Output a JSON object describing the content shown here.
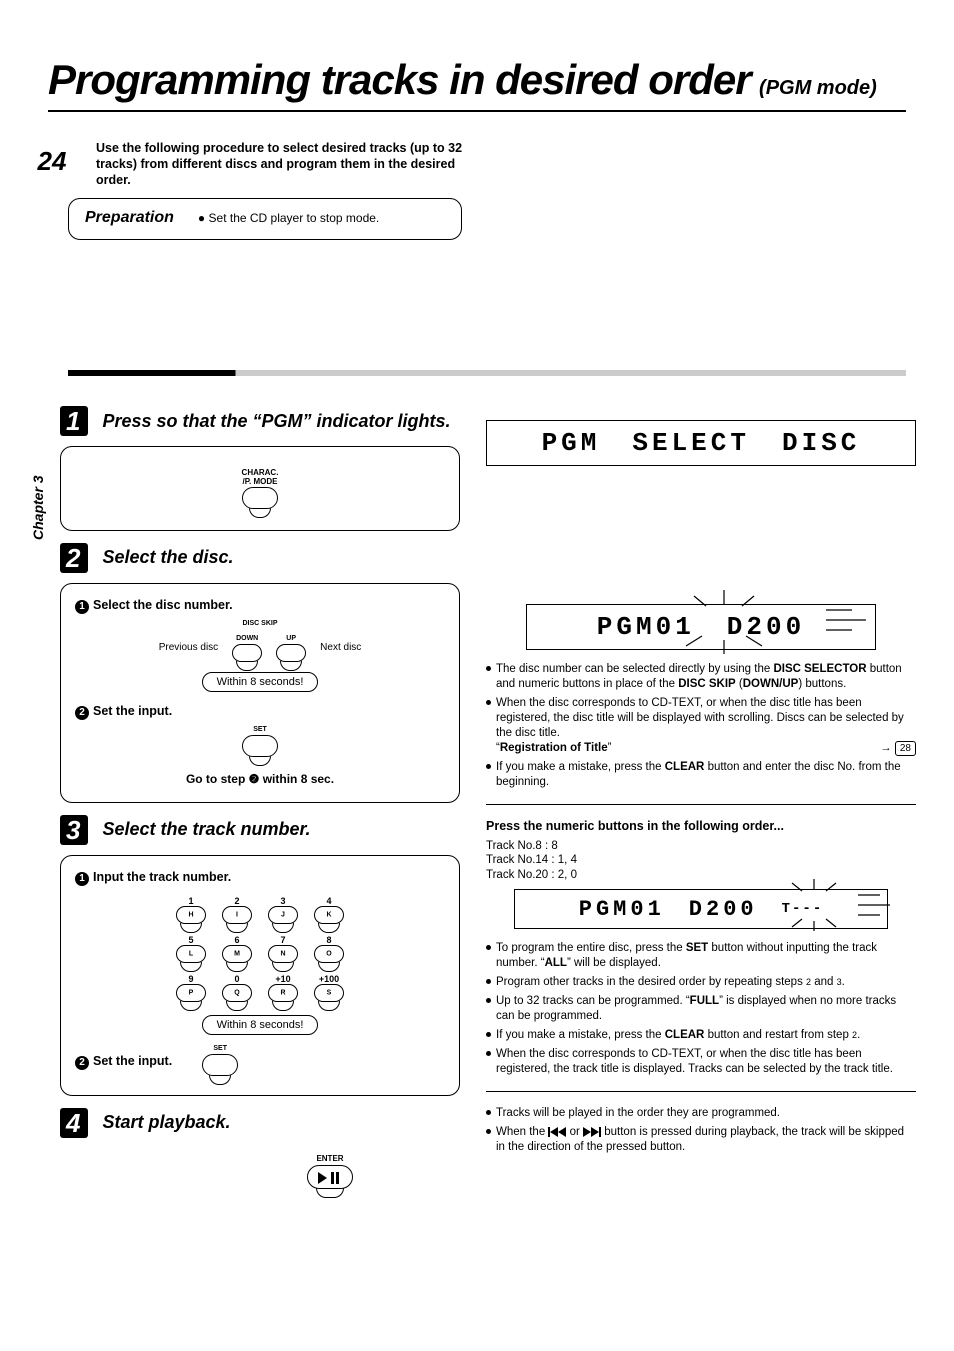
{
  "page_number": "24",
  "chapter_label": "Chapter 3",
  "title": {
    "main": "Programming tracks in desired order",
    "sub": "(PGM mode)"
  },
  "intro": "Use the following procedure to select desired tracks (up to 32 tracks) from different discs and program them in the desired order.",
  "preparation": {
    "heading": "Preparation",
    "item": "Set the CD player to stop mode."
  },
  "steps": {
    "s1": {
      "num": "1",
      "title": "Press so that the “PGM” indicator lights.",
      "btn_top": "CHARAC.",
      "btn_bot": "/P. MODE"
    },
    "s2": {
      "num": "2",
      "title": "Select the disc.",
      "sub1": "Select the disc number.",
      "disc_skip": "DISC SKIP",
      "down": "DOWN",
      "up": "UP",
      "prev": "Previous disc",
      "next": "Next disc",
      "within": "Within 8 seconds!",
      "sub2": "Set the input.",
      "set_label": "SET",
      "goto": "Go to step ❷ within 8 sec."
    },
    "s3": {
      "num": "3",
      "title": "Select the track number.",
      "sub1": "Input the track number.",
      "within": "Within 8 seconds!",
      "sub2": "Set the input.",
      "set_label": "SET",
      "keys_num": [
        "1",
        "2",
        "3",
        "4",
        "5",
        "6",
        "7",
        "8",
        "9",
        "0",
        "+10",
        "+100"
      ],
      "keys_let": [
        "H",
        "I",
        "J",
        "K",
        "L",
        "M",
        "N",
        "O",
        "P",
        "Q",
        "R",
        "S"
      ]
    },
    "s4": {
      "num": "4",
      "title": "Start playback.",
      "enter_label": "ENTER"
    }
  },
  "lcd": {
    "s1": [
      "PGM",
      "SELECT",
      "DISC"
    ],
    "s2": [
      "PGM01",
      "D200"
    ],
    "s3": [
      "PGM01",
      "D200",
      "T---"
    ]
  },
  "notes": {
    "s2": {
      "n1a": "The disc number can be selected directly by using the ",
      "n1b": "DISC SELECTOR",
      "n1c": " button and numeric buttons in place of the ",
      "n1d": "DISC SKIP",
      "n1e": " (",
      "n1f": "DOWN/UP",
      "n1g": ") buttons.",
      "n2": "When the disc corresponds to CD-TEXT, or when the disc title has been registered, the disc title will be displayed with scrolling. Discs can be selected by the disc title.",
      "reg_title_label": "Registration of Title",
      "page_ref": "28",
      "n3a": "If you make a mistake, press the ",
      "n3b": "CLEAR",
      "n3c": " button and enter the disc No. from the beginning."
    },
    "s3": {
      "header": "Press the numeric buttons in the following order...",
      "e1": "Track No.8   : 8",
      "e2": "Track No.14 : 1, 4",
      "e3": "Track No.20 : 2, 0",
      "p1a": "To program the entire disc, press the ",
      "p1b": "SET",
      "p1c": " button without inputting the track number.  “",
      "p1d": "ALL",
      "p1e": "” will be displayed.",
      "p2a": "Program other tracks in the desired order by repeating steps ",
      "p2b": " and ",
      "p2c": ".",
      "p3a": "Up to 32 tracks can be programmed.  “",
      "p3b": "FULL",
      "p3c": "” is displayed when no more tracks can be programmed.",
      "p4a": "If you make a mistake, press the ",
      "p4b": "CLEAR",
      "p4c": " button and restart from step ",
      "p4d": ".",
      "p5": "When the disc corresponds to CD-TEXT, or when the disc title has been registered, the track title is displayed.  Tracks can be selected by the track title.",
      "pb1": "Tracks will be played in the order they are programmed.",
      "pb2a": "When the ",
      "pb2b": " or ",
      "pb2c": " button is pressed during playback, the track will be skipped in the direction of the pressed button."
    }
  }
}
